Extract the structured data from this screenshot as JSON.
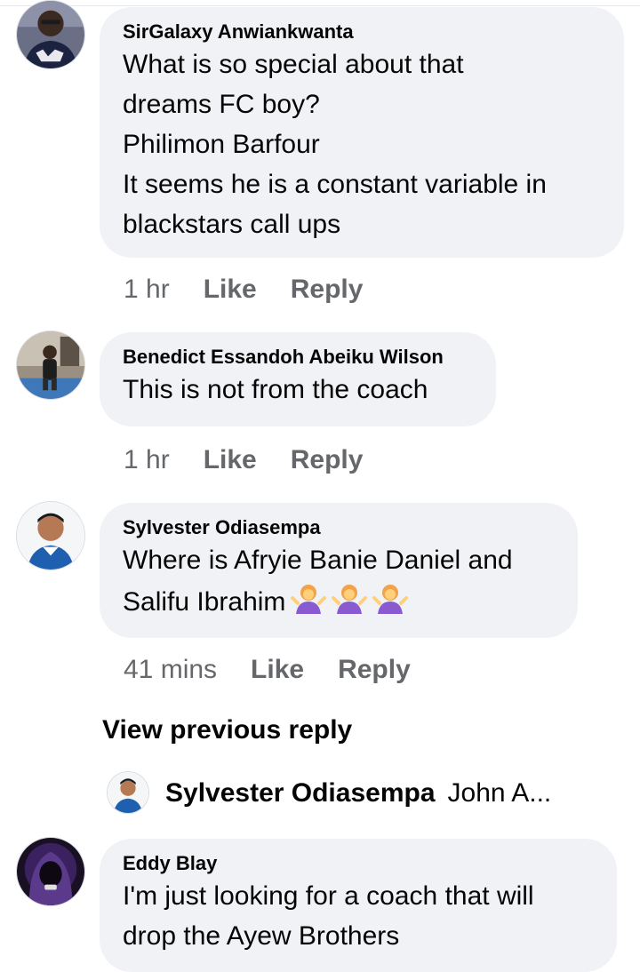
{
  "comments": [
    {
      "author": "SirGalaxy Anwiankwanta",
      "lines": [
        "What is so special about that",
        "dreams FC boy?",
        "Philimon Barfour",
        "It seems he is a constant variable in",
        "blackstars call ups"
      ],
      "time": "1 hr",
      "like_label": "Like",
      "reply_label": "Reply"
    },
    {
      "author": "Benedict Essandoh Abeiku Wilson",
      "lines": [
        "This is not from the coach"
      ],
      "time": "1 hr",
      "like_label": "Like",
      "reply_label": "Reply"
    },
    {
      "author": "Sylvester Odiasempa",
      "lines": [
        "Where is Afryie Banie Daniel and",
        "Salifu Ibrahim"
      ],
      "emoji": "woman-shrugging-icon",
      "time": "41 mins",
      "like_label": "Like",
      "reply_label": "Reply"
    },
    {
      "author": "Eddy Blay",
      "lines": [
        "I'm just looking for a coach that will",
        "drop the Ayew Brothers"
      ]
    }
  ],
  "view_previous_reply": "View previous reply",
  "reply_preview": {
    "author": "Sylvester Odiasempa",
    "snippet": "John A..."
  },
  "colors": {
    "bubble": "#f0f2f5",
    "meta_text": "#65676b",
    "primary_text": "#050505"
  }
}
